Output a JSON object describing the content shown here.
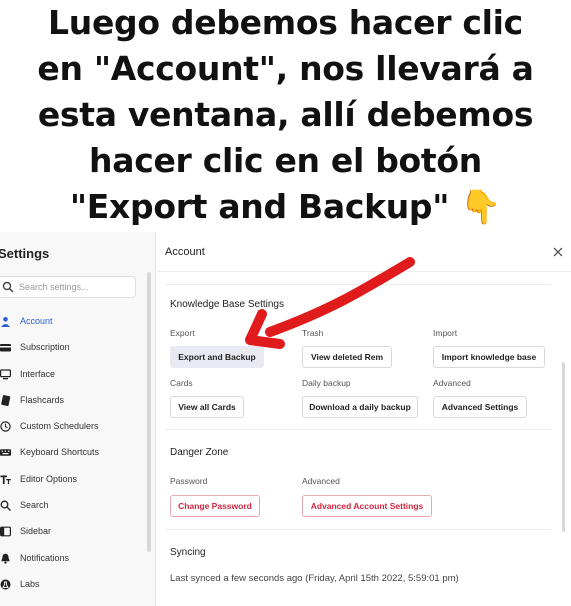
{
  "caption": {
    "lines": [
      "Luego debemos hacer clic",
      "en \"Account\", nos llevará a",
      "esta ventana, allí debemos",
      "hacer clic en el botón",
      "\"Export and Backup\" 👇"
    ]
  },
  "sidebar": {
    "title": "Settings",
    "search_placeholder": "Search settings...",
    "items": [
      {
        "label": "Account",
        "icon": "user-icon"
      },
      {
        "label": "Subscription",
        "icon": "card-icon"
      },
      {
        "label": "Interface",
        "icon": "monitor-icon"
      },
      {
        "label": "Flashcards",
        "icon": "flashcards-icon"
      },
      {
        "label": "Custom Schedulers",
        "icon": "clock-icon"
      },
      {
        "label": "Keyboard Shortcuts",
        "icon": "keyboard-icon"
      },
      {
        "label": "Editor Options",
        "icon": "text-format-icon"
      },
      {
        "label": "Search",
        "icon": "search-icon"
      },
      {
        "label": "Sidebar",
        "icon": "sidebar-icon"
      },
      {
        "label": "Notifications",
        "icon": "bell-icon"
      },
      {
        "label": "Labs",
        "icon": "labs-icon"
      }
    ]
  },
  "main": {
    "title": "Account",
    "knowledge_base": {
      "title": "Knowledge Base Settings",
      "export_label": "Export",
      "trash_label": "Trash",
      "import_label": "Import",
      "export_backup_button": "Export and Backup",
      "view_deleted_button": "View deleted Rem",
      "import_kb_button": "Import knowledge base",
      "cards_label": "Cards",
      "daily_backup_label": "Daily backup",
      "advanced_label": "Advanced",
      "view_all_cards_button": "View all Cards",
      "download_backup_button": "Download a daily backup",
      "advanced_settings_button": "Advanced Settings"
    },
    "danger_zone": {
      "title": "Danger Zone",
      "password_label": "Password",
      "advanced_label": "Advanced",
      "change_password_button": "Change Password",
      "advanced_account_button": "Advanced Account Settings"
    },
    "syncing": {
      "title": "Syncing",
      "status": "Last synced a few seconds ago (Friday, April 15th 2022, 5:59:01 pm)"
    }
  },
  "colors": {
    "accent": "#2f5fd0",
    "danger": "#d2253f",
    "annotation_arrow": "#e01b1b",
    "selected_button": "#e9e9f1"
  }
}
